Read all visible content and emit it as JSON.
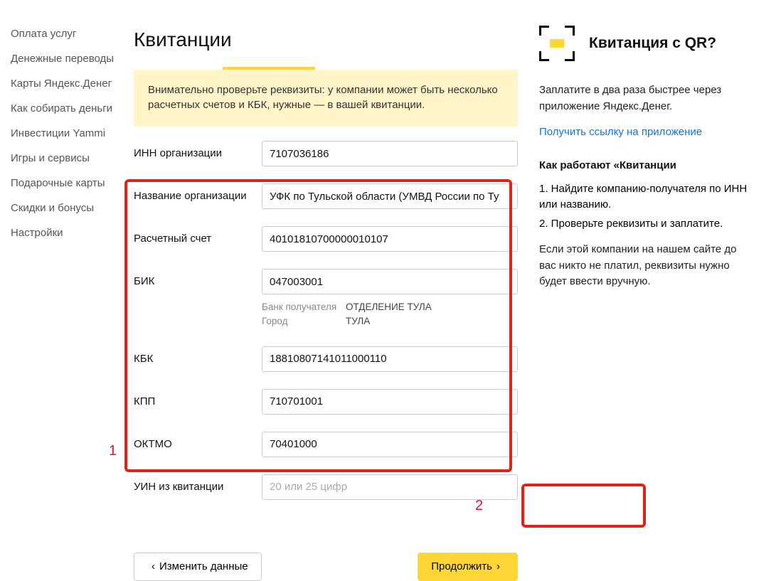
{
  "sidebar": {
    "items": [
      {
        "label": "Оплата услуг"
      },
      {
        "label": "Денежные переводы"
      },
      {
        "label": "Карты Яндекс.Денег"
      },
      {
        "label": "Как собирать деньги"
      },
      {
        "label": "Инвестиции Yammi"
      },
      {
        "label": "Игры и сервисы"
      },
      {
        "label": "Подарочные карты"
      },
      {
        "label": "Скидки и бонусы"
      },
      {
        "label": "Настройки"
      }
    ]
  },
  "main": {
    "title": "Квитанции",
    "warning": "Внимательно проверьте реквизиты: у компании может быть несколько расчетных счетов и КБК, нужные — в вашей квитанции.",
    "form": {
      "inn": {
        "label": "ИНН организации",
        "value": "7107036186"
      },
      "name": {
        "label": "Название организации",
        "value": "УФК по Тульской области (УМВД России по Ту"
      },
      "account": {
        "label": "Расчетный счет",
        "value": "40101810700000010107"
      },
      "bik": {
        "label": "БИК",
        "value": "047003001"
      },
      "bank_label": "Банк получателя",
      "bank_value": "ОТДЕЛЕНИЕ ТУЛА",
      "city_label": "Город",
      "city_value": "ТУЛА",
      "kbk": {
        "label": "КБК",
        "value": "18810807141011000110"
      },
      "kpp": {
        "label": "КПП",
        "value": "710701001"
      },
      "oktmo": {
        "label": "ОКТМО",
        "value": "70401000"
      },
      "uin": {
        "label": "УИН из квитанции",
        "placeholder": "20 или 25 цифр"
      }
    },
    "btn_back": "Изменить данные",
    "btn_next": "Продолжить",
    "marker1": "1",
    "marker2": "2"
  },
  "right": {
    "qr_title": "Квитанция с QR?",
    "lead": "Заплатите в два раза быстрее через приложение Яндекс.Денег.",
    "link": "Получить ссылку на приложение",
    "how_title": "Как работают «Квитанции",
    "step1": "1. Найдите компанию-получателя по ИНН или названию.",
    "step2": "2. Проверьте реквизиты и заплатите.",
    "note": "Если этой компании на нашем сайте до вас никто не платил, реквизиты нужно будет ввести вручную."
  }
}
